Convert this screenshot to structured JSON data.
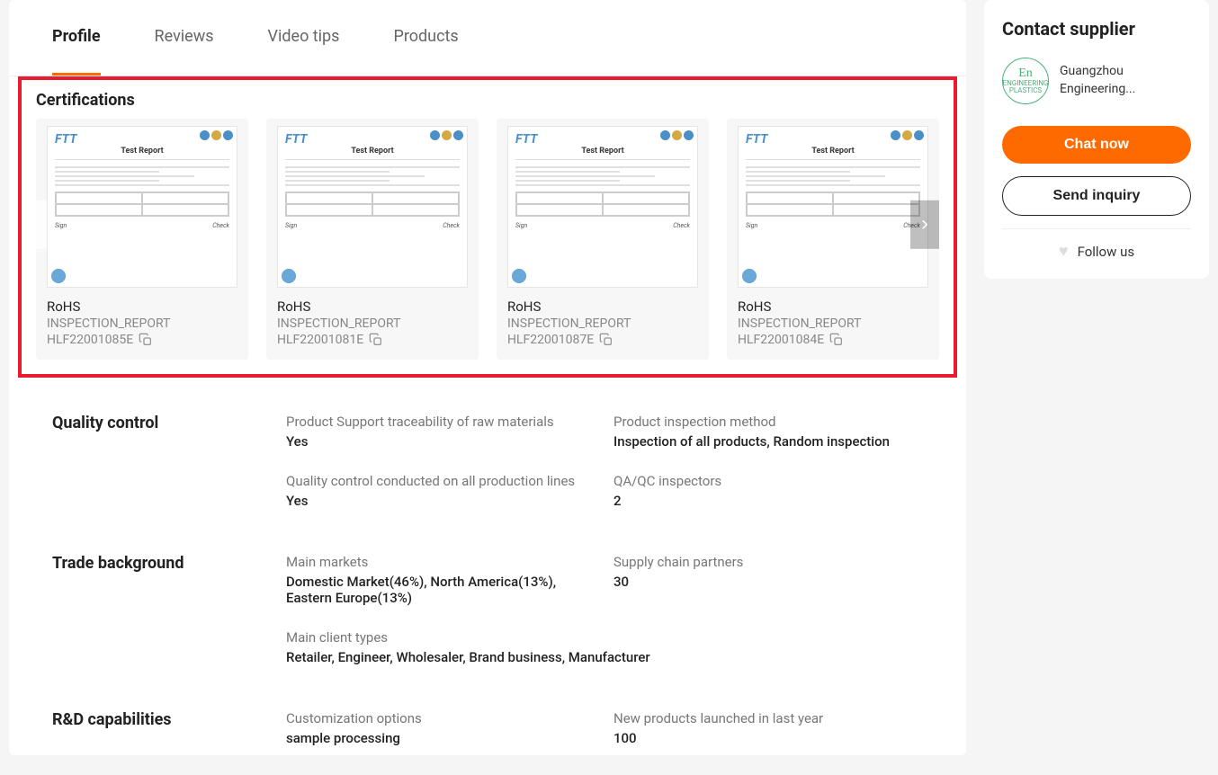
{
  "tabs": [
    "Profile",
    "Reviews",
    "Video tips",
    "Products"
  ],
  "certifications": {
    "title": "Certifications",
    "items": [
      {
        "label": "RoHS",
        "sub1": "INSPECTION_REPORT",
        "sub2": "HLF22001085E"
      },
      {
        "label": "RoHS",
        "sub1": "INSPECTION_REPORT",
        "sub2": "HLF22001081E"
      },
      {
        "label": "RoHS",
        "sub1": "INSPECTION_REPORT",
        "sub2": "HLF22001087E"
      },
      {
        "label": "RoHS",
        "sub1": "INSPECTION_REPORT",
        "sub2": "HLF22001084E"
      }
    ],
    "doc_logo": "FTT",
    "doc_title": "Test Report"
  },
  "quality": {
    "title": "Quality control",
    "traceability_label": "Product Support traceability of raw materials",
    "traceability_value": "Yes",
    "inspection_label": "Product inspection method",
    "inspection_value": "Inspection of all products, Random inspection",
    "qc_lines_label": "Quality control conducted on all production lines",
    "qc_lines_value": "Yes",
    "qaqc_label": "QA/QC inspectors",
    "qaqc_value": "2"
  },
  "trade": {
    "title": "Trade background",
    "markets_label": "Main markets",
    "markets_value": "Domestic Market(46%), North America(13%), Eastern Europe(13%)",
    "partners_label": "Supply chain partners",
    "partners_value": "30",
    "clients_label": "Main client types",
    "clients_value": "Retailer, Engineer, Wholesaler, Brand business, Manufacturer"
  },
  "rnd": {
    "title": "R&D capabilities",
    "custom_label": "Customization options",
    "custom_value": "sample processing",
    "newprod_label": "New products launched in last year",
    "newprod_value": "100"
  },
  "sidebar": {
    "title": "Contact supplier",
    "supplier_name": "Guangzhou Engineering...",
    "logo_en": "En",
    "logo_sub": "ENGINEERING PLASTICS",
    "chat": "Chat now",
    "inquiry": "Send inquiry",
    "follow": "Follow us"
  }
}
